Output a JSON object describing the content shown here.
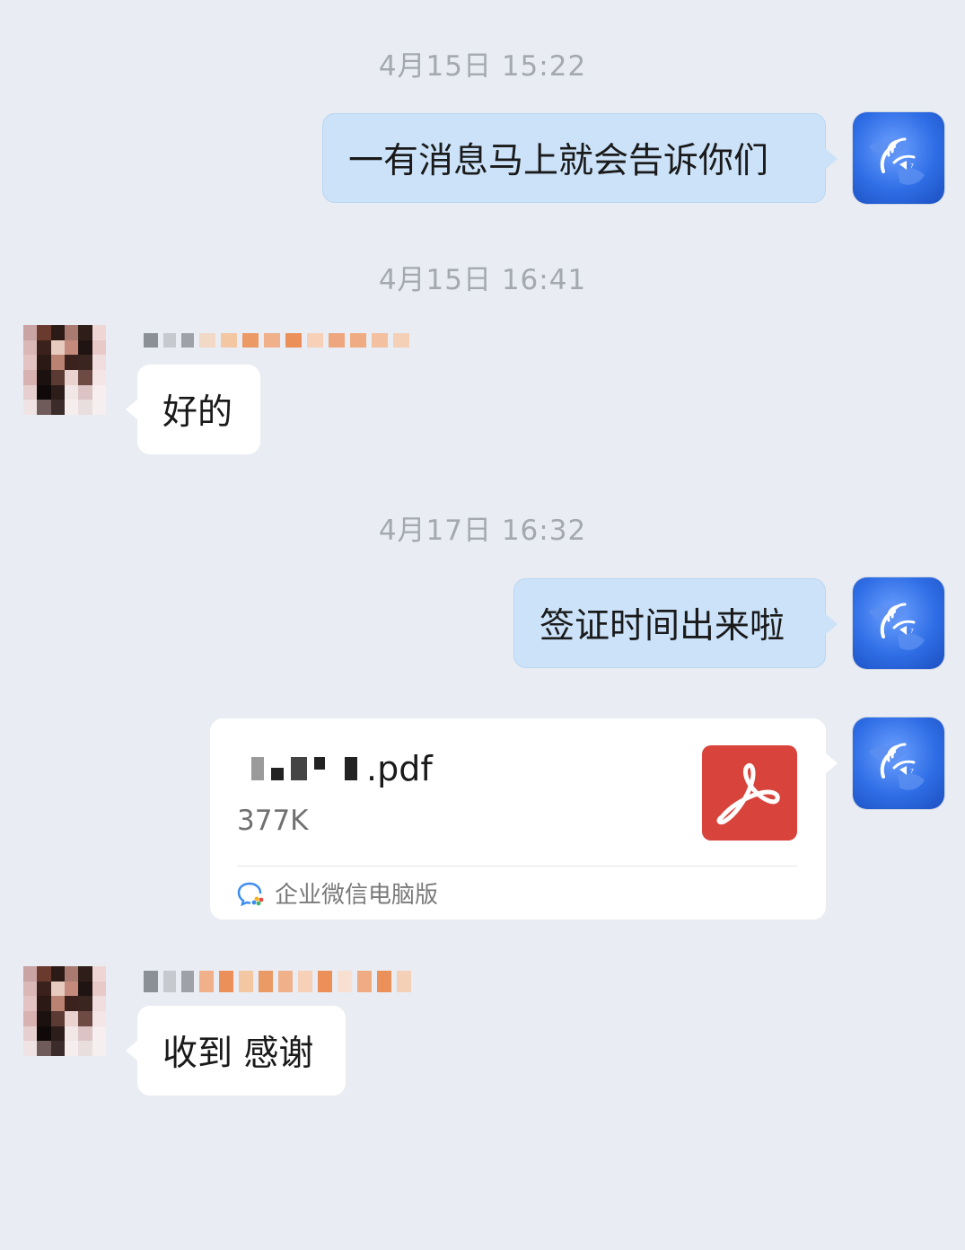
{
  "timestamps": [
    "4月15日 15:22",
    "4月15日 16:41",
    "4月17日 16:32"
  ],
  "messages": {
    "m1": "一有消息马上就会告诉你们",
    "m2": "好的",
    "m3": "签证时间出来啦",
    "m4": "收到 感谢"
  },
  "file": {
    "name_suffix": ".pdf",
    "size": "377K",
    "source_label": "企业微信电脑版",
    "icon": "pdf-icon"
  },
  "colors": {
    "background": "#e9ecf2",
    "outgoing_bubble": "#cbe2f9",
    "incoming_bubble": "#ffffff",
    "pdf_red": "#d8433c"
  }
}
